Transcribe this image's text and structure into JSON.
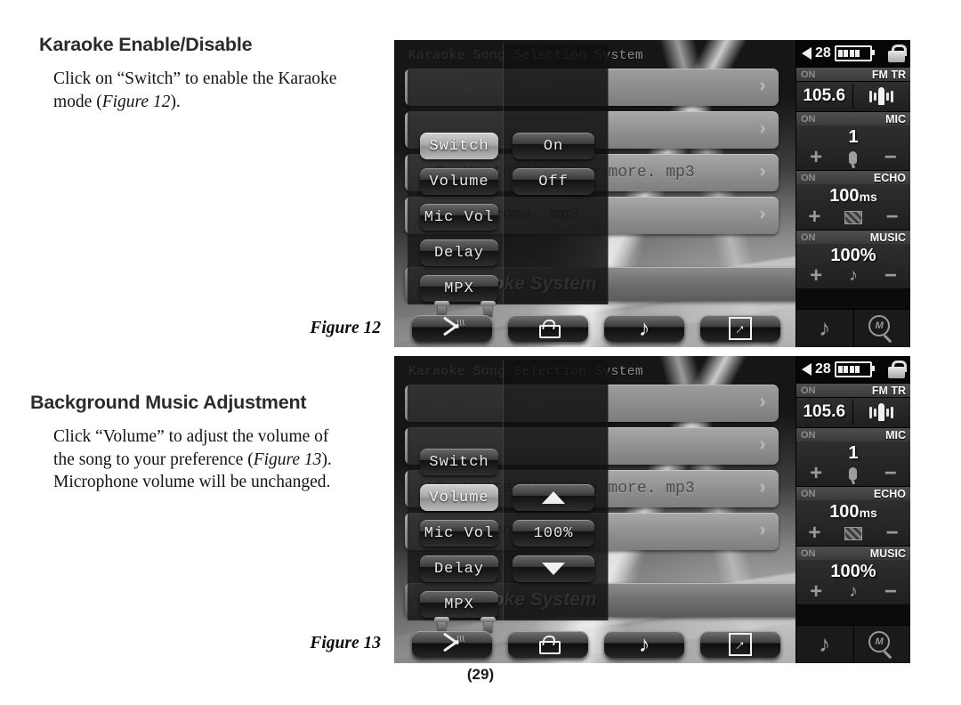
{
  "page": {
    "number": "(29)"
  },
  "sections": [
    {
      "heading": "Karaoke Enable/Disable",
      "body_pre": "Click on “Switch” to enable the Karaoke mode (",
      "body_italic": "Figure 12",
      "body_post": ").",
      "caption": "Figure 12"
    },
    {
      "heading": "Background Music Adjustment",
      "body_pre": "Click “Volume” to adjust the volume of the song to your preference (",
      "body_italic": "Figure 13",
      "body_post": "). Microphone volume will be unchanged.",
      "caption": "Figure 13"
    }
  ],
  "device": {
    "app_title": "Karaoke Song Selection System",
    "footer_title": "Karaoke System",
    "songs": [
      {
        "label": "1. Love. mp3",
        "chevron": "›"
      },
      {
        "label": "",
        "chevron": "›"
      },
      {
        "label": "2. Yesterday once more. mp3",
        "chevron": "›"
      },
      {
        "label": "3. Welcome. mp3",
        "chevron": "›"
      }
    ],
    "annotation_arrow": "❯",
    "menu": [
      {
        "label": "Switch"
      },
      {
        "label": "Volume"
      },
      {
        "label": "Mic Vol"
      },
      {
        "label": "Delay"
      },
      {
        "label": "MPX"
      }
    ],
    "toolbar": [
      {
        "icon": "tools-mic-icon"
      },
      {
        "icon": "lock-icon"
      },
      {
        "icon": "music-note-icon"
      },
      {
        "icon": "arrow-down-right-icon"
      }
    ],
    "status": {
      "speaker_icon": "speaker-icon",
      "volume": "28",
      "battery_bars": 4,
      "lock_icon": "padlock-icon"
    },
    "sidebar": {
      "fm": {
        "state": "ON",
        "name": "FM TR",
        "value": "105.6",
        "icon": "antenna-icon"
      },
      "mic": {
        "state": "ON",
        "name": "MIC",
        "value": "1",
        "icon": "microphone-icon",
        "plus": "+",
        "minus": "−"
      },
      "echo": {
        "state": "ON",
        "name": "ECHO",
        "value": "100",
        "unit": "ms",
        "icon": "echo-icon",
        "plus": "+",
        "minus": "−"
      },
      "music": {
        "state": "ON",
        "name": "MUSIC",
        "value": "100%",
        "icon": "music-note-icon",
        "plus": "+",
        "minus": "−"
      },
      "footer": [
        {
          "icon": "music-note-icon"
        },
        {
          "icon": "magnifier-m-icon",
          "letter": "M"
        }
      ]
    }
  },
  "figure12": {
    "selected_menu": "Switch",
    "options": [
      {
        "label": "On"
      },
      {
        "label": "Off"
      }
    ]
  },
  "figure13": {
    "selected_menu": "Volume",
    "options": [
      {
        "label": "▲",
        "kind": "up"
      },
      {
        "label": "100%",
        "kind": "value"
      },
      {
        "label": "▼",
        "kind": "down"
      }
    ]
  },
  "colors": {
    "page_bg": "#ffffff",
    "heading": "#2b2b2b",
    "body": "#141414",
    "screen_bg": "#0b0b0b",
    "accent_light": "#f0f0f0"
  }
}
